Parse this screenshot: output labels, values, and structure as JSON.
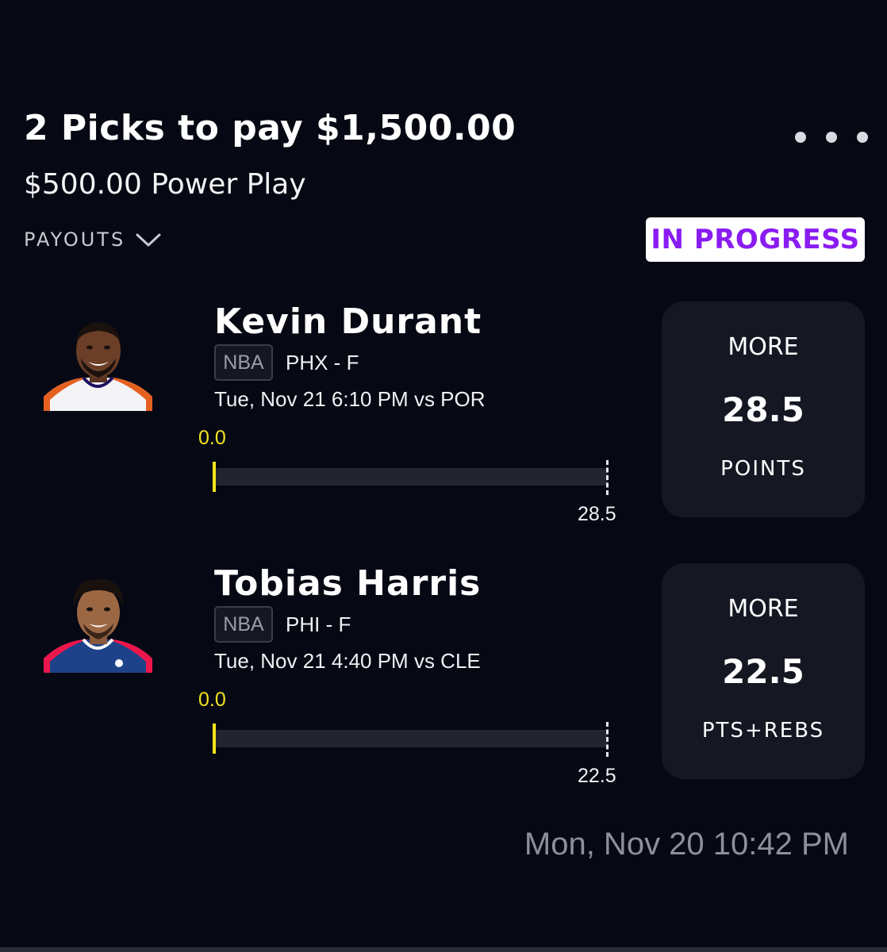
{
  "header": {
    "title": "2 Picks to pay $1,500.00",
    "subtitle": "$500.00 Power Play",
    "payouts_label": "PAYOUTS",
    "status": "IN PROGRESS"
  },
  "picks": [
    {
      "player": "Kevin Durant",
      "league": "NBA",
      "team_pos": "PHX - F",
      "game": "Tue, Nov 21 6:10 PM  vs POR",
      "current": "0.0",
      "target": "28.5",
      "direction": "MORE",
      "line": "28.5",
      "stat": "POINTS",
      "jersey_color": "#f4f4f6",
      "trim_color": "#e56020"
    },
    {
      "player": "Tobias Harris",
      "league": "NBA",
      "team_pos": "PHI - F",
      "game": "Tue, Nov 21 4:40 PM  vs CLE",
      "current": "0.0",
      "target": "22.5",
      "direction": "MORE",
      "line": "22.5",
      "stat": "PTS+REBS",
      "jersey_color": "#1d428a",
      "trim_color": "#ed174c"
    }
  ],
  "footer": {
    "timestamp": "Mon, Nov 20 10:42 PM"
  },
  "icons": {
    "menu": "more-horizontal-icon",
    "payouts": "chevron-down-icon"
  },
  "colors": {
    "background": "#060913",
    "card": "#151823",
    "accent": "#8a1cf2",
    "progress": "#f2e21d"
  }
}
